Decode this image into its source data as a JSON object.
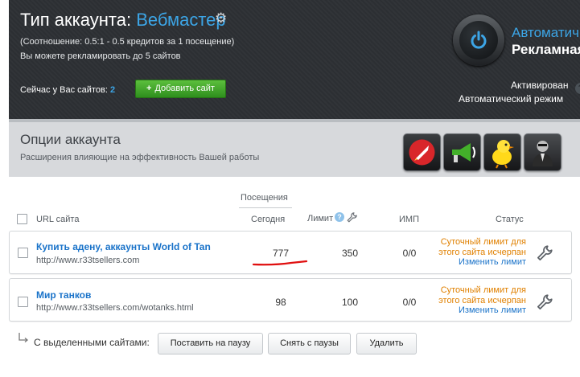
{
  "header": {
    "title_prefix": "Тип аккаунта:",
    "account_type": "Вебмастер",
    "ratio_text": "(Соотношение: 0.5:1 - 0.5 кредитов за 1 посещение)",
    "limit_text": "Вы можете рекламировать до 5 сайтов",
    "sites_label": "Сейчас у Вас сайтов:",
    "sites_count": "2",
    "add_site_button": "Добавить сайт",
    "auto_title": "Автоматич",
    "auto_subtitle": "Рекламная",
    "activated": "Активирован",
    "auto_mode": "Автоматический режим",
    "help_symbol": "?"
  },
  "options": {
    "title": "Опции аккаунта",
    "description": "Расширения влияющие на эффективность Вашей работы",
    "icons": [
      "rocket-icon",
      "megaphone-icon",
      "chick-icon",
      "agent-icon"
    ]
  },
  "table": {
    "group_header": "Посещения",
    "columns": {
      "url": "URL сайта",
      "today": "Сегодня",
      "limit": "Лимит",
      "imp": "ИМП",
      "status": "Статус"
    },
    "rows": [
      {
        "name": "Купить адену, аккаунты World of Tan",
        "url": "http://www.r33tsellers.com",
        "today": "777",
        "limit": "350",
        "imp": "0/0",
        "status_line1": "Суточный лимит для",
        "status_line2": "этого сайта исчерпан",
        "status_link": "Изменить лимит"
      },
      {
        "name": "Мир танков",
        "url": "http://www.r33tsellers.com/wotanks.html",
        "today": "98",
        "limit": "100",
        "imp": "0/0",
        "status_line1": "Суточный лимит для",
        "status_line2": "этого сайта исчерпан",
        "status_link": "Изменить лимит"
      }
    ]
  },
  "bulk": {
    "label": "С выделенными сайтами:",
    "pause": "Поставить на паузу",
    "unpause": "Снять с паузы",
    "delete": "Удалить"
  },
  "colors": {
    "header_bg": "#2c2f33",
    "accent_blue": "#3ca5e6",
    "add_green": "#3fa829",
    "warning_orange": "#e08000",
    "link_blue": "#1a73c9",
    "annotation_red": "#e01010"
  }
}
